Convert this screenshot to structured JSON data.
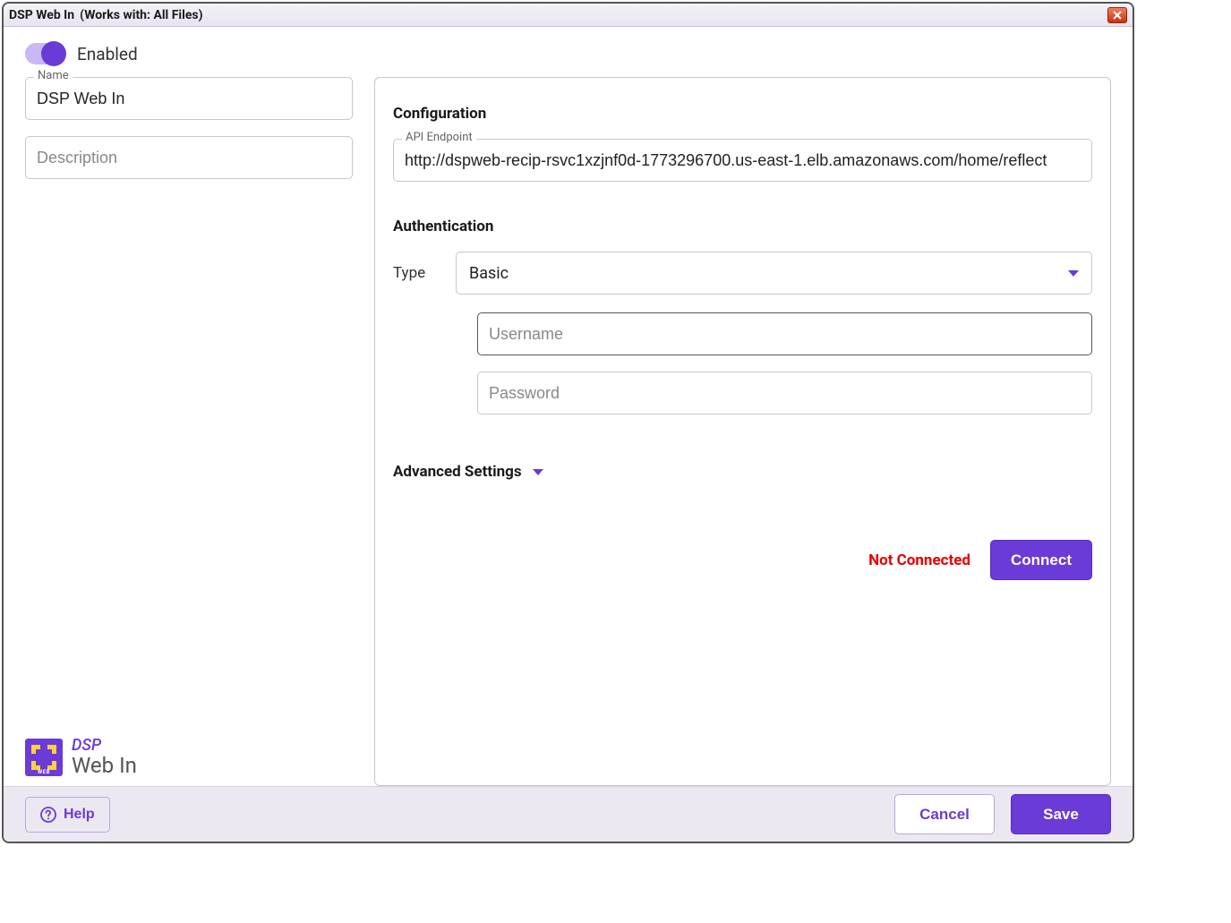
{
  "titlebar": {
    "title": "DSP Web In",
    "subtitle": "(Works with: All Files)"
  },
  "toggle": {
    "label": "Enabled"
  },
  "left": {
    "name_legend": "Name",
    "name_value": "DSP Web In",
    "description_placeholder": "Description"
  },
  "config": {
    "heading": "Configuration",
    "endpoint_legend": "API Endpoint",
    "endpoint_value": "http://dspweb-recip-rsvc1xzjnf0d-1773296700.us-east-1.elb.amazonaws.com/home/reflect"
  },
  "auth": {
    "heading": "Authentication",
    "type_label": "Type",
    "type_value": "Basic",
    "username_placeholder": "Username",
    "password_placeholder": "Password"
  },
  "advanced": {
    "label": "Advanced Settings"
  },
  "connection": {
    "status": "Not Connected",
    "connect_label": "Connect"
  },
  "logo": {
    "line1": "DSP",
    "line2": "Web In",
    "badge": "WEB"
  },
  "footer": {
    "help": "Help",
    "cancel": "Cancel",
    "save": "Save"
  }
}
